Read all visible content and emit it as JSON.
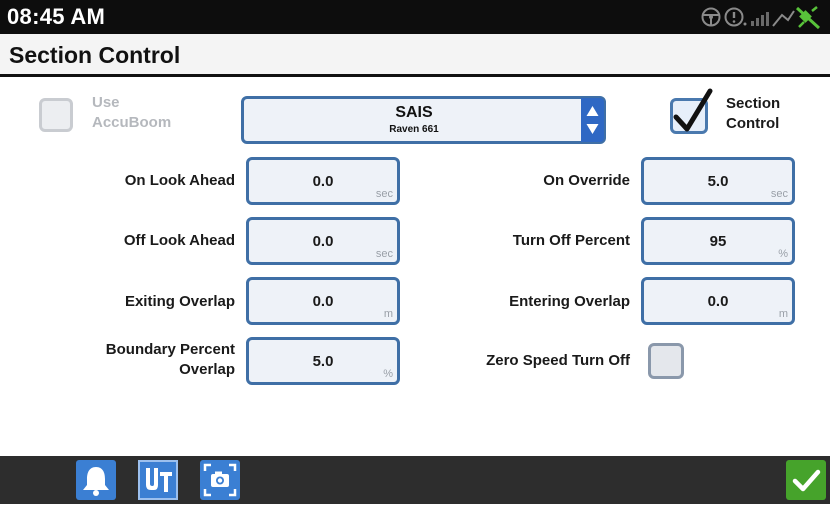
{
  "status_bar": {
    "time": "08:45 AM",
    "icons": [
      "steering-wheel-icon",
      "alert-status-icon",
      "signal-bars-icon",
      "satellite-icon"
    ]
  },
  "header": {
    "title": "Section Control"
  },
  "use_accuboom": {
    "label_line1": "Use",
    "label_line2": "AccuBoom",
    "checked": false,
    "enabled": false
  },
  "controller": {
    "value": "SAIS",
    "subvalue": "Raven 661"
  },
  "section_control": {
    "label_line1": "Section",
    "label_line2": "Control",
    "checked": true
  },
  "fields": {
    "on_look_ahead": {
      "label": "On Look Ahead",
      "value": "0.0",
      "unit": "sec"
    },
    "off_look_ahead": {
      "label": "Off Look Ahead",
      "value": "0.0",
      "unit": "sec"
    },
    "exiting_overlap": {
      "label": "Exiting Overlap",
      "value": "0.0",
      "unit": "m"
    },
    "boundary_percent_overlap": {
      "label_line1": "Boundary Percent",
      "label_line2": "Overlap",
      "value": "5.0",
      "unit": "%"
    },
    "on_override": {
      "label": "On Override",
      "value": "5.0",
      "unit": "sec"
    },
    "turn_off_percent": {
      "label": "Turn Off Percent",
      "value": "95",
      "unit": "%"
    },
    "entering_overlap": {
      "label": "Entering Overlap",
      "value": "0.0",
      "unit": "m"
    }
  },
  "zero_speed_turn_off": {
    "label": "Zero Speed Turn Off",
    "checked": false
  },
  "bottom_bar": {
    "buttons": [
      "bell-icon",
      "universal-terminal-icon",
      "screenshot-icon"
    ],
    "confirm": "checkmark-icon"
  },
  "colors": {
    "accent_blue": "#3b7fd3",
    "field_border": "#3f6fa6",
    "confirm_green": "#46a32b",
    "bar_dark": "#0d0d0d"
  }
}
